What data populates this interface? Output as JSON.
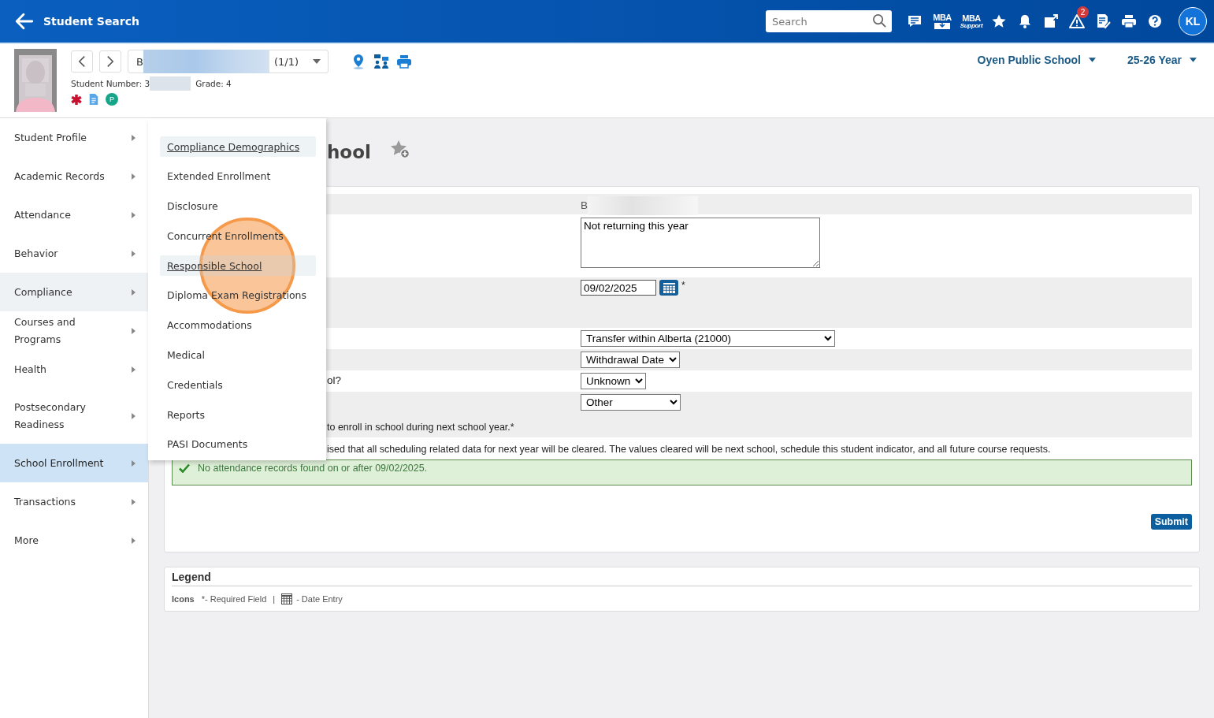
{
  "header": {
    "back_label": "Student Search",
    "search_placeholder": "Search",
    "avatar": "KL",
    "tools": [
      {
        "kind": "messages"
      },
      {
        "kind": "mba",
        "label": "MBA"
      },
      {
        "kind": "mba-support",
        "label": "MBA",
        "sublabel": "Support"
      },
      {
        "kind": "star"
      },
      {
        "kind": "bell"
      },
      {
        "kind": "external"
      },
      {
        "kind": "alert",
        "badge": "2"
      },
      {
        "kind": "checklist"
      },
      {
        "kind": "print"
      },
      {
        "kind": "help"
      }
    ]
  },
  "student": {
    "name": "B",
    "count": "(1/1)",
    "number_label": "Student Number: 3",
    "grade": "Grade: 4",
    "actions": [
      {
        "kind": "location"
      },
      {
        "kind": "contacts"
      },
      {
        "kind": "print"
      }
    ],
    "flags": [
      {
        "kind": "medical"
      },
      {
        "kind": "document"
      },
      {
        "kind": "badge",
        "label": "P"
      }
    ],
    "school": "Oyen Public School",
    "year": "25-26 Year"
  },
  "sidebar": {
    "items": [
      {
        "label": "Student Profile",
        "selected": false,
        "hovered": false
      },
      {
        "label": "Academic Records",
        "selected": false,
        "hovered": false
      },
      {
        "label": "Attendance",
        "selected": false,
        "hovered": false
      },
      {
        "label": "Behavior",
        "selected": false,
        "hovered": false
      },
      {
        "label": "Compliance",
        "selected": false,
        "hovered": true
      },
      {
        "label": "Courses and Programs",
        "selected": false,
        "hovered": false
      },
      {
        "label": "Health",
        "selected": false,
        "hovered": false
      },
      {
        "label": "Postsecondary Readiness",
        "selected": false,
        "hovered": false
      },
      {
        "label": "School Enrollment",
        "selected": true,
        "hovered": false
      },
      {
        "label": "Transactions",
        "selected": false,
        "hovered": false
      },
      {
        "label": "More",
        "selected": false,
        "hovered": false
      }
    ]
  },
  "flyout": {
    "items": [
      {
        "label": "Compliance Demographics",
        "highlighted": true,
        "marked": false
      },
      {
        "label": "Extended Enrollment",
        "highlighted": false,
        "marked": false
      },
      {
        "label": "Disclosure",
        "highlighted": false,
        "marked": false
      },
      {
        "label": "Concurrent Enrollments",
        "highlighted": false,
        "marked": false
      },
      {
        "label": "Responsible School",
        "highlighted": true,
        "marked": true
      },
      {
        "label": "Diploma Exam Registrations",
        "highlighted": false,
        "marked": false
      },
      {
        "label": "Accommodations",
        "highlighted": false,
        "marked": false
      },
      {
        "label": "Medical",
        "highlighted": false,
        "marked": false
      },
      {
        "label": "Credentials",
        "highlighted": false,
        "marked": false
      },
      {
        "label": "Reports",
        "highlighted": false,
        "marked": false
      },
      {
        "label": "PASI Documents",
        "highlighted": false,
        "marked": false
      }
    ]
  },
  "page": {
    "title": "hool",
    "form": {
      "rows": [
        {
          "kind": "text",
          "value": "B"
        },
        {
          "kind": "textarea",
          "value": "Not returning this year"
        },
        {
          "kind": "date",
          "value": "09/02/2025",
          "required_mark": "*"
        },
        {
          "kind": "select",
          "value": "Transfer within Alberta (21000)"
        },
        {
          "kind": "select",
          "value": "Withdrawal Date"
        },
        {
          "kind": "select",
          "label": "ol?",
          "value": "Unknown"
        },
        {
          "kind": "select",
          "value": "Other",
          "note": "to enroll in school during next school year.*"
        }
      ],
      "notice": "ised that all scheduling related data for next year will be cleared. The values cleared will be next school, schedule this student indicator, and all future course requests.",
      "success": "No attendance records found on or after 09/02/2025.",
      "submit": "Submit"
    },
    "legend": {
      "title": "Legend",
      "label": "Icons",
      "items": [
        {
          "kind": "required",
          "text": "*- Required Field"
        },
        {
          "kind": "date",
          "text": "- Date Entry"
        }
      ],
      "separator": "|"
    }
  }
}
